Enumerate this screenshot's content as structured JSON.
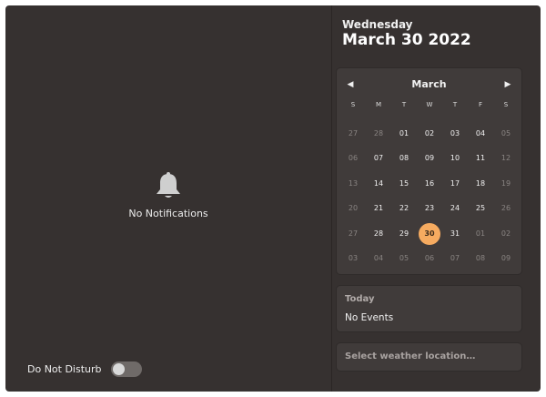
{
  "notifications": {
    "empty_text": "No Notifications",
    "icon": "bell-icon"
  },
  "dnd": {
    "label": "Do Not Disturb",
    "enabled": false
  },
  "header": {
    "weekday": "Wednesday",
    "date": "March 30 2022"
  },
  "calendar": {
    "month": "March",
    "prev_icon": "chevron-left-icon",
    "next_icon": "chevron-right-icon",
    "days_of_week": [
      "S",
      "M",
      "T",
      "W",
      "T",
      "F",
      "S"
    ],
    "weeks": [
      [
        {
          "d": "27",
          "o": true
        },
        {
          "d": "28",
          "o": true
        },
        {
          "d": "01"
        },
        {
          "d": "02"
        },
        {
          "d": "03"
        },
        {
          "d": "04"
        },
        {
          "d": "05",
          "o": true
        }
      ],
      [
        {
          "d": "06",
          "o": true
        },
        {
          "d": "07"
        },
        {
          "d": "08"
        },
        {
          "d": "09"
        },
        {
          "d": "10"
        },
        {
          "d": "11"
        },
        {
          "d": "12",
          "o": true
        }
      ],
      [
        {
          "d": "13",
          "o": true
        },
        {
          "d": "14"
        },
        {
          "d": "15"
        },
        {
          "d": "16"
        },
        {
          "d": "17"
        },
        {
          "d": "18"
        },
        {
          "d": "19",
          "o": true
        }
      ],
      [
        {
          "d": "20",
          "o": true
        },
        {
          "d": "21"
        },
        {
          "d": "22"
        },
        {
          "d": "23"
        },
        {
          "d": "24"
        },
        {
          "d": "25"
        },
        {
          "d": "26",
          "o": true
        }
      ],
      [
        {
          "d": "27",
          "o": true
        },
        {
          "d": "28"
        },
        {
          "d": "29"
        },
        {
          "d": "30",
          "today": true
        },
        {
          "d": "31"
        },
        {
          "d": "01",
          "o": true
        },
        {
          "d": "02",
          "o": true
        }
      ],
      [
        {
          "d": "03",
          "o": true
        },
        {
          "d": "04",
          "o": true
        },
        {
          "d": "05",
          "o": true
        },
        {
          "d": "06",
          "o": true
        },
        {
          "d": "07",
          "o": true
        },
        {
          "d": "08",
          "o": true
        },
        {
          "d": "09",
          "o": true
        }
      ]
    ]
  },
  "events": {
    "title": "Today",
    "empty_text": "No Events"
  },
  "weather": {
    "placeholder": "Select weather location…"
  },
  "colors": {
    "background": "#363130",
    "card": "#403b3a",
    "accent_today": "#f6ab60"
  }
}
